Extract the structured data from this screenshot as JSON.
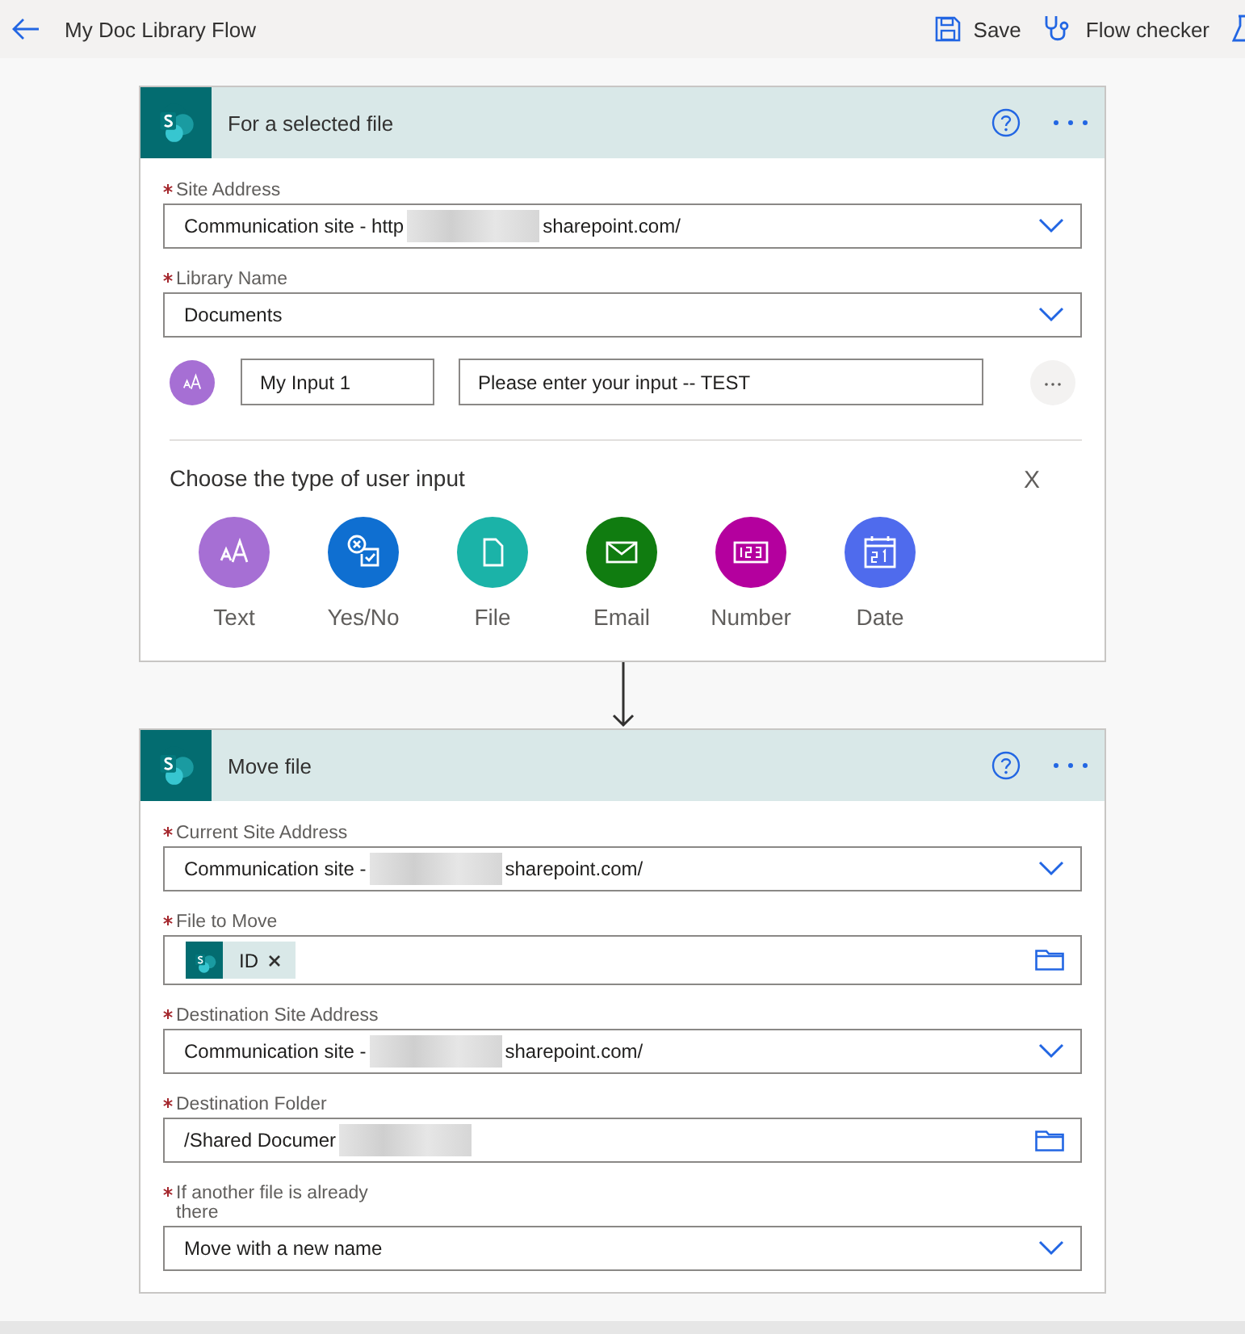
{
  "top_bar": {
    "title": "My Doc Library Flow",
    "actions": [
      {
        "kind": "save",
        "label": "Save"
      },
      {
        "kind": "checker",
        "label": "Flow checker"
      },
      {
        "kind": "test"
      }
    ]
  },
  "cards": [
    {
      "title": "For a selected file",
      "fields": [
        {
          "kind": "dropdown",
          "label": "Site Address",
          "required": true,
          "value": "Communication site - http",
          "redacted": true,
          "value_end": "sharepoint.com/"
        },
        {
          "kind": "dropdown",
          "label": "Library Name",
          "required": true,
          "value": "Documents"
        }
      ],
      "user_input": {
        "name": "My Input 1",
        "prompt": "Please enter your input -- TEST"
      },
      "chooser": {
        "title": "Choose the type of user input",
        "close": "X",
        "types": [
          {
            "kind": "text",
            "label": "Text",
            "color": "#a66fd4"
          },
          {
            "kind": "yesno",
            "label": "Yes/No",
            "color": "#0f6fd1"
          },
          {
            "kind": "file",
            "label": "File",
            "color": "#1bb3a8"
          },
          {
            "kind": "email",
            "label": "Email",
            "color": "#107c10"
          },
          {
            "kind": "number",
            "label": "Number",
            "color": "#b4009e"
          },
          {
            "kind": "date",
            "label": "Date",
            "color": "#4f6bed"
          }
        ]
      }
    },
    {
      "title": "Move file",
      "fields": [
        {
          "kind": "dropdown",
          "label": "Current Site Address",
          "required": true,
          "value": "Communication site -",
          "redacted": true,
          "value_end": "sharepoint.com/"
        },
        {
          "kind": "token",
          "label": "File to Move",
          "required": true,
          "tokens": [
            {
              "label": "ID"
            }
          ]
        },
        {
          "kind": "dropdown",
          "label": "Destination Site Address",
          "required": true,
          "value": "Communication site -",
          "redacted": true,
          "value_end": "sharepoint.com/"
        },
        {
          "kind": "folder",
          "label": "Destination Folder",
          "required": true,
          "value": "/Shared Documer",
          "redacted": true
        },
        {
          "kind": "dropdown",
          "label": "If another file is already there",
          "required": true,
          "value": "Move with a new name"
        }
      ]
    }
  ]
}
